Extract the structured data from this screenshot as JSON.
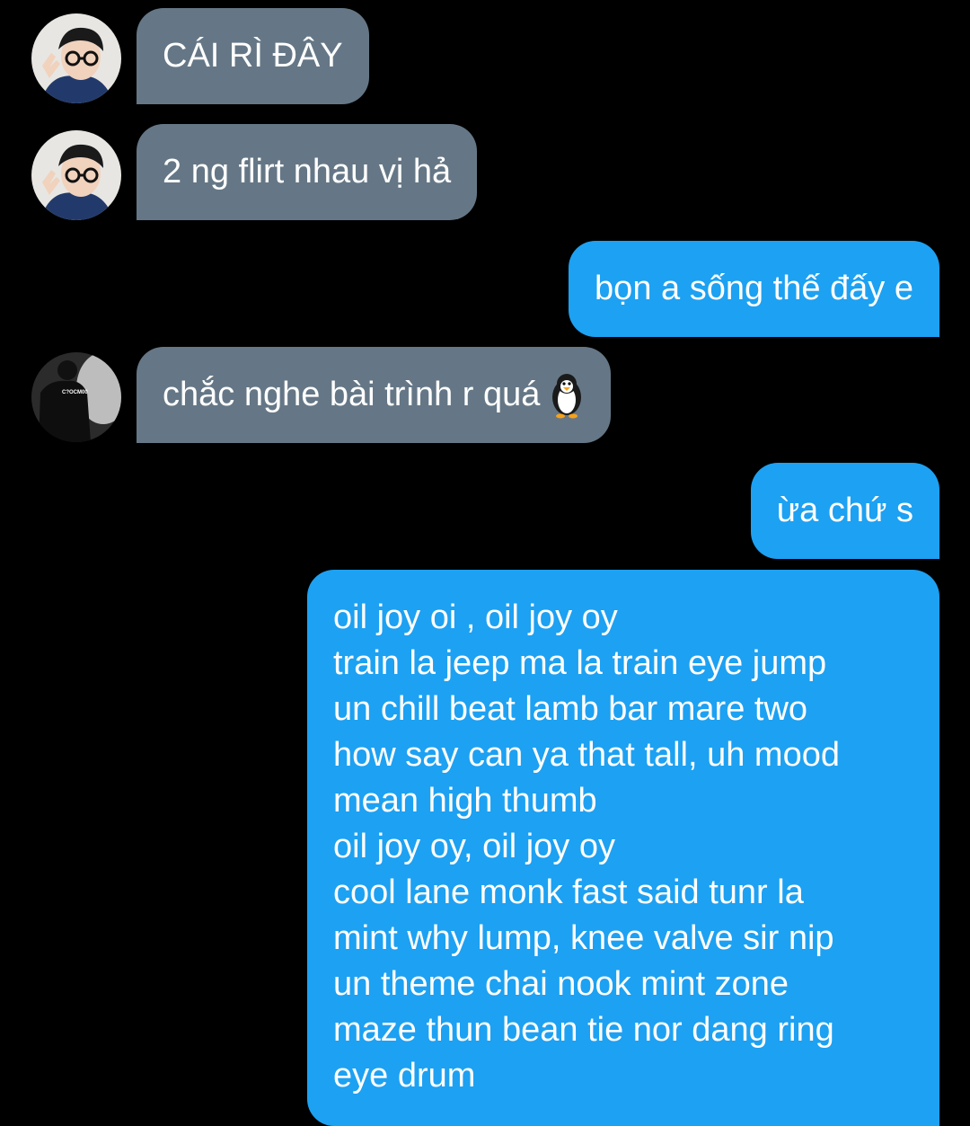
{
  "messages": [
    {
      "text": "CÁI RÌ ĐÂY"
    },
    {
      "text": "2 ng flirt nhau vị hả"
    },
    {
      "text": "bọn a sống thế đấy e"
    },
    {
      "text": "chắc nghe bài trình r quá",
      "emoji": "penguin-icon"
    },
    {
      "text": "ừa chứ s"
    },
    {
      "lines": [
        "oil joy oi , oil joy oy",
        "train la jeep ma la train eye jump",
        "un chill beat lamb bar mare two",
        "how say can ya that tall, uh mood",
        "mean high thumb",
        "oil joy oy, oil joy oy",
        "cool lane monk fast said tunr la",
        "mint why lump, knee valve sir nip",
        "un theme chai nook mint zone",
        "maze thun bean tie nor dang ring",
        "eye drum"
      ]
    }
  ],
  "avatars": {
    "shirt_text": "C?OCM00"
  },
  "colors": {
    "incoming": "#657786",
    "outgoing": "#1da1f2",
    "background": "#000000"
  }
}
